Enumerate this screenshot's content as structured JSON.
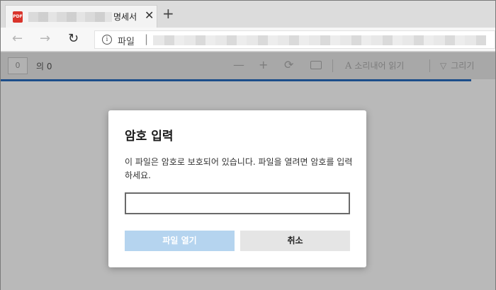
{
  "browser": {
    "tab": {
      "icon": "pdf-file-icon",
      "icon_text": "PDF",
      "title_suffix": "명세서",
      "close": "✕"
    },
    "new_tab": "+",
    "nav": {
      "back": "←",
      "forward": "→",
      "reload": "↻"
    },
    "address": {
      "info_icon": "i",
      "scheme_label": "파일",
      "separator": "|"
    }
  },
  "pdf_toolbar": {
    "page_input": "0",
    "page_of": "의 0",
    "zoom_out": "—",
    "zoom_in": "+",
    "rotate": "⟳",
    "read_aloud_icon": "A",
    "read_aloud": "소리내어 읽기",
    "draw_icon": "▽",
    "draw": "그리기"
  },
  "dialog": {
    "title": "암호 입력",
    "message": "이 파일은 암호로 보호되어 있습니다. 파일을 열려면 암호를 입력하세요.",
    "password_value": "",
    "open_button": "파일 열기",
    "cancel_button": "취소"
  },
  "colors": {
    "accent_progress": "#1d4e8a",
    "open_button_disabled": "#b5d4ef",
    "pdf_icon": "#d9342b"
  }
}
